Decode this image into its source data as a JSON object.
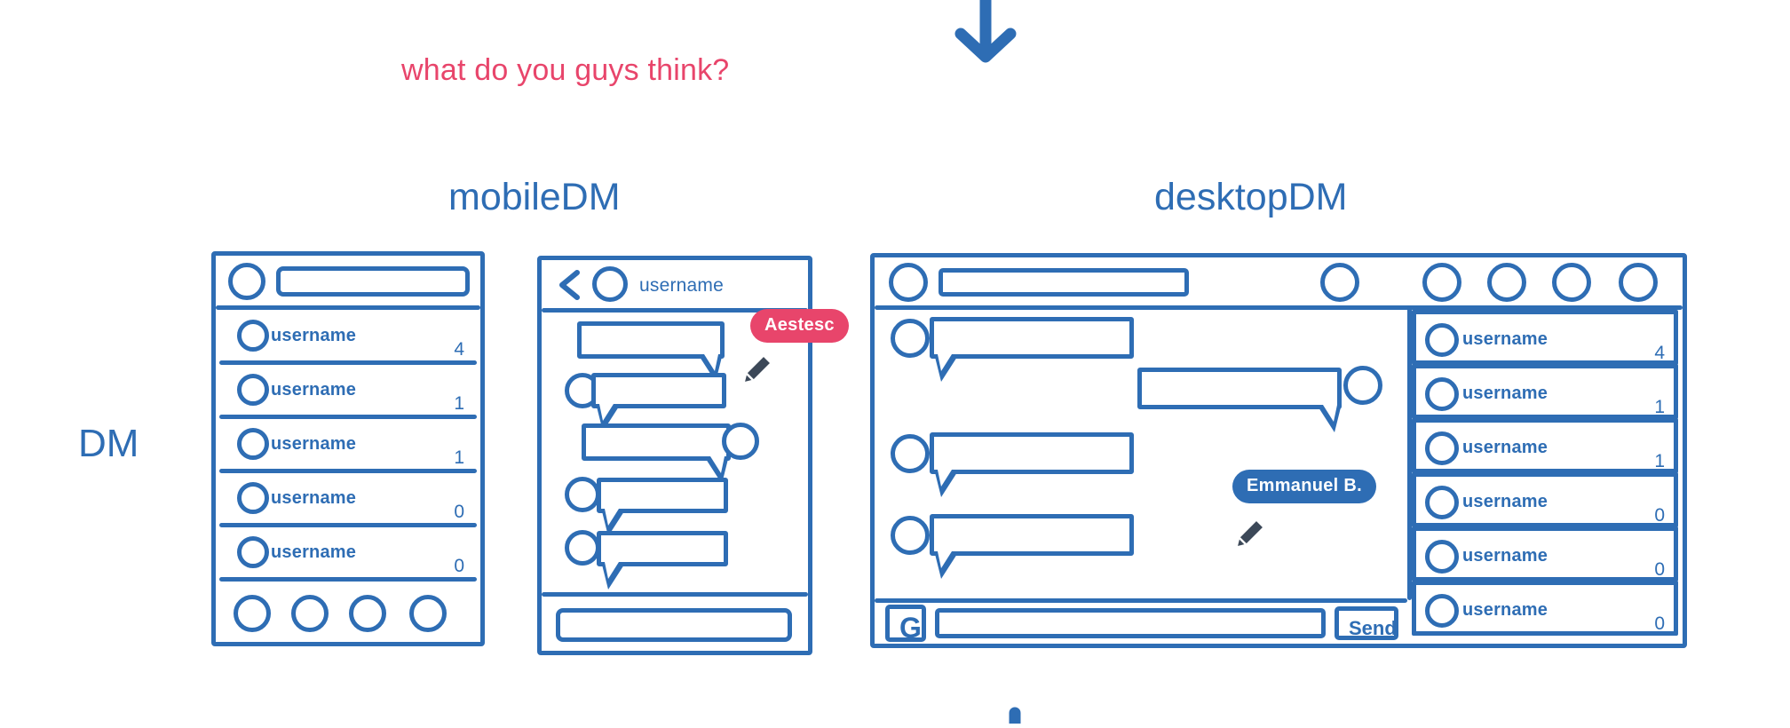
{
  "annotation": {
    "note": "what do you guys think?",
    "note_color": "#E8456B",
    "arrow_down_icon": "arrow-down-icon",
    "arrow_color": "#2E6DB4"
  },
  "palette": {
    "wireframe_blue": "#2E6DB4",
    "accent_pink": "#E8456B",
    "cursor_dark": "#3C4858",
    "background": "#FFFFFF"
  },
  "row_label": "DM",
  "sections": [
    {
      "id": "mobile",
      "title": "mobileDM"
    },
    {
      "id": "desktop",
      "title": "desktopDM"
    }
  ],
  "mobile_list": {
    "header": {
      "avatar_icon": "avatar-circle-icon",
      "search_field_value": "",
      "search_field_placeholder": ""
    },
    "conversations": [
      {
        "name": "username",
        "count": "4",
        "avatar_icon": "avatar-circle-icon"
      },
      {
        "name": "username",
        "count": "1",
        "avatar_icon": "avatar-circle-icon"
      },
      {
        "name": "username",
        "count": "1",
        "avatar_icon": "avatar-circle-icon"
      },
      {
        "name": "username",
        "count": "0",
        "avatar_icon": "avatar-circle-icon"
      },
      {
        "name": "username",
        "count": "0",
        "avatar_icon": "avatar-circle-icon"
      }
    ],
    "tabbar": {
      "items": [
        "tab-home-icon",
        "tab-search-icon",
        "tab-activity-icon",
        "tab-profile-icon"
      ]
    }
  },
  "mobile_chat": {
    "header": {
      "back_icon": "chevron-left-icon",
      "avatar_icon": "avatar-circle-icon",
      "title": "username"
    },
    "messages": [
      {
        "side": "right",
        "text": "",
        "avatar": false
      },
      {
        "side": "left",
        "text": "",
        "avatar": true
      },
      {
        "side": "right",
        "text": "",
        "avatar": true
      },
      {
        "side": "left",
        "text": "",
        "avatar": true
      },
      {
        "side": "left",
        "text": "",
        "avatar": true
      }
    ],
    "composer": {
      "value": "",
      "placeholder": ""
    },
    "cursor": {
      "label": "Aestesc",
      "color": "#E8456B",
      "pointer_icon": "pencil-cursor-icon"
    }
  },
  "desktop": {
    "header": {
      "avatar_icon": "avatar-circle-icon",
      "search_field_value": "",
      "search_field_placeholder": "",
      "nav_icons": [
        "nav-home-icon",
        "nav-compass-icon",
        "nav-heart-icon",
        "nav-message-icon",
        "nav-profile-icon"
      ]
    },
    "messages": [
      {
        "side": "left",
        "text": "",
        "avatar": true
      },
      {
        "side": "right",
        "text": "",
        "avatar": true
      },
      {
        "side": "left",
        "text": "",
        "avatar": true
      },
      {
        "side": "left",
        "text": "",
        "avatar": true
      }
    ],
    "composer": {
      "prefix_button": "G",
      "value": "",
      "placeholder": "",
      "send_label": "Send"
    },
    "sidebar": [
      {
        "name": "username",
        "count": "4",
        "avatar_icon": "avatar-circle-icon"
      },
      {
        "name": "username",
        "count": "1",
        "avatar_icon": "avatar-circle-icon"
      },
      {
        "name": "username",
        "count": "1",
        "avatar_icon": "avatar-circle-icon"
      },
      {
        "name": "username",
        "count": "0",
        "avatar_icon": "avatar-circle-icon"
      },
      {
        "name": "username",
        "count": "0",
        "avatar_icon": "avatar-circle-icon"
      },
      {
        "name": "username",
        "count": "0",
        "avatar_icon": "avatar-circle-icon"
      }
    ],
    "cursor": {
      "label": "Emmanuel B.",
      "color": "#2E6DB4",
      "pointer_icon": "pencil-cursor-icon"
    }
  }
}
